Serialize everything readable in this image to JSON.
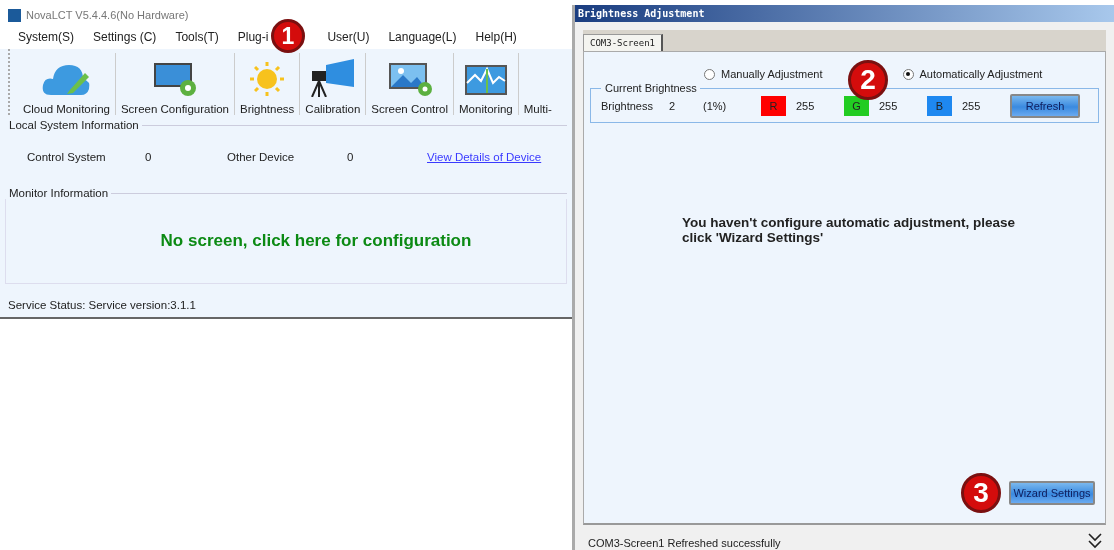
{
  "main_window": {
    "title": "NovaLCT V5.4.4.6(No Hardware)",
    "menu": [
      "System(S)",
      "Settings (C)",
      "Tools(T)",
      "Plug-i",
      "User(U)",
      "Language(L)",
      "Help(H)"
    ],
    "toolbar": [
      {
        "label": "Cloud Monitoring",
        "kind": "cloud"
      },
      {
        "label": "Screen Configuration",
        "kind": "screen-gear"
      },
      {
        "label": "Brightness",
        "kind": "sun"
      },
      {
        "label": "Calibration",
        "kind": "camera"
      },
      {
        "label": "Screen Control",
        "kind": "picture-gear"
      },
      {
        "label": "Monitoring",
        "kind": "wave"
      },
      {
        "label": "Multi-",
        "kind": "none"
      }
    ],
    "local_info": {
      "title": "Local System Information",
      "control_label": "Control System",
      "control_value": "0",
      "other_label": "Other Device",
      "other_value": "0",
      "link": "View Details of Device"
    },
    "monitor_info": {
      "title": "Monitor Information",
      "message": "No screen, click here for configuration"
    },
    "status": "Service Status:  Service version:3.1.1"
  },
  "dialog": {
    "title": "Brightness Adjustment",
    "tabs": [
      {
        "label": "COM3-Screen1",
        "selected": true
      }
    ],
    "modes": [
      {
        "label": "Manually Adjustment",
        "selected": false
      },
      {
        "label": "Automatically Adjustment",
        "selected": true
      }
    ],
    "current": {
      "title": "Current Brightness",
      "label": "Brightness",
      "value": "2",
      "percent": "(1%)",
      "channels": [
        {
          "name": "R",
          "color": "#ff0000",
          "value": "255"
        },
        {
          "name": "G",
          "color": "#22cc22",
          "value": "255"
        },
        {
          "name": "B",
          "color": "#1e88f0",
          "value": "255"
        }
      ],
      "refresh": "Refresh"
    },
    "message": "You haven't configure automatic adjustment, please click 'Wizard Settings'",
    "wizard": "Wizard Settings",
    "status": "COM3-Screen1 Refreshed successfully"
  },
  "callouts": [
    "1",
    "2",
    "3"
  ]
}
